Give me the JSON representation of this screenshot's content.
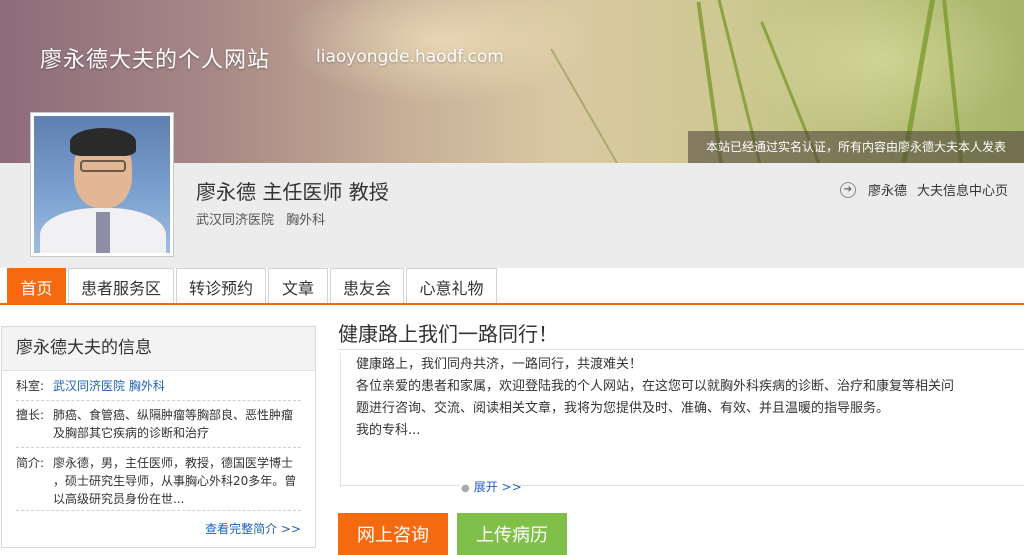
{
  "header": {
    "site_title": "廖永德大夫的个人网站",
    "site_url": "liaoyongde.haodf.com",
    "verify_notice": "本站已经通过实名认证，所有内容由廖永德大夫本人发表"
  },
  "profile": {
    "name_title": "廖永德  主任医师 教授",
    "hospital": "武汉同济医院",
    "department": "胸外科",
    "home_link_name": "廖永德",
    "home_link_label": "大夫信息中心页"
  },
  "tabs": [
    "首页",
    "患者服务区",
    "转诊预约",
    "文章",
    "患友会",
    "心意礼物"
  ],
  "info_box": {
    "title": "廖永德大夫的信息",
    "dept_label": "科室:",
    "dept_value": "武汉同济医院 胸外科",
    "skill_label": "擅长:",
    "skill_line1": "肺癌、食管癌、纵隔肿瘤等胸部良、恶性肿瘤",
    "skill_line2": "及胸部其它疾病的诊断和治疗",
    "intro_label": "简介:",
    "intro_line1": "廖永德，男，主任医师，教授，德国医学博士",
    "intro_line2": "，硕士研究生导师，从事胸心外科20多年。曾",
    "intro_line3": "以高级研究员身份在世...",
    "more_link": "查看完整简介 >>"
  },
  "main": {
    "title": "健康路上我们一路同行！",
    "line1": "健康路上，我们同舟共济，一路同行，共渡难关！",
    "line2": "各位亲爱的患者和家属，欢迎登陆我的个人网站，在这您可以就胸外科疾病的诊断、治疗和康复等相关问",
    "line3": "题进行咨询、交流、阅读相关文章，我将为您提供及时、准确、有效、并且温暖的指导服务。",
    "line4": "我的专科...",
    "expand": "展开 >>",
    "consult_button": "网上咨询",
    "upload_button": "上传病历"
  },
  "colors": {
    "accent_orange": "#f56a0e",
    "accent_green": "#80c04a",
    "link_blue": "#1f62b8"
  }
}
